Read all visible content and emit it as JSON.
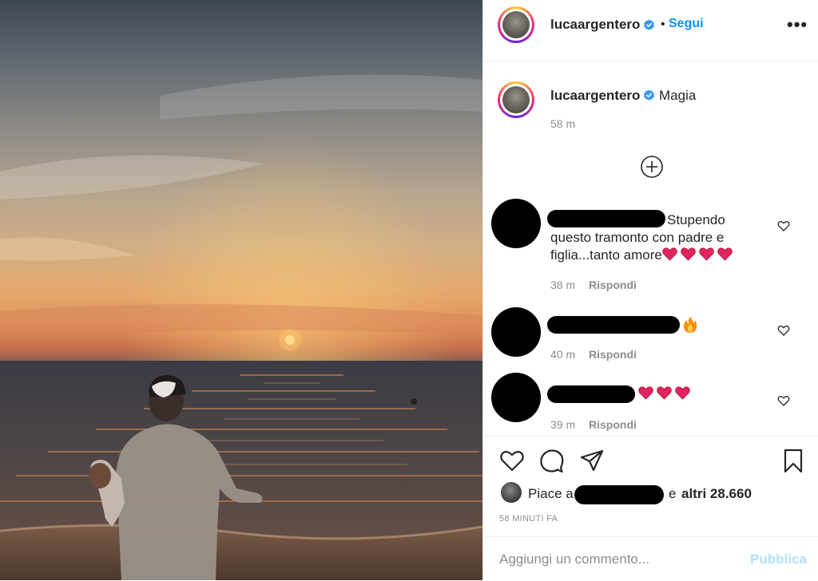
{
  "post": {
    "image_alt": "Silhouette of a father holding a baby on the beach at sunset",
    "author": {
      "username": "lucaargentero",
      "verified": true,
      "follow_label": "Segui",
      "separator": "•",
      "more_label": "•••"
    },
    "caption": {
      "username": "lucaargentero",
      "text": "Magia",
      "time": "58 m"
    },
    "load_more_icon": "plus-circle-icon",
    "comments": [
      {
        "text_line1": "Stupendo",
        "text_line2": "questo tramonto con padre e",
        "text_line3": "figlia...tanto amore",
        "emoji": [
          "red-heart",
          "red-heart",
          "red-heart",
          "red-heart"
        ],
        "time": "38 m",
        "reply_label": "Rispondi"
      },
      {
        "emoji": [
          "fire"
        ],
        "time": "40 m",
        "reply_label": "Rispondi"
      },
      {
        "emoji": [
          "red-heart",
          "red-heart",
          "red-heart"
        ],
        "time": "39 m",
        "reply_label": "Rispondi"
      }
    ],
    "actions": [
      "heart-icon",
      "comment-icon",
      "share-icon",
      "bookmark-icon"
    ],
    "likes": {
      "prefix": "Piace a",
      "suffix_plain": "e",
      "suffix_bold": "altri 28.660"
    },
    "posted_ago": "58 MINUTI FA",
    "comment_box": {
      "placeholder": "Aggiungi un commento...",
      "publish_label": "Pubblica"
    }
  },
  "colors": {
    "link_blue": "#0095f6",
    "publish_disabled": "#b2dffc",
    "muted_text": "#8e8e8e",
    "heart_red": "#e0245e"
  }
}
